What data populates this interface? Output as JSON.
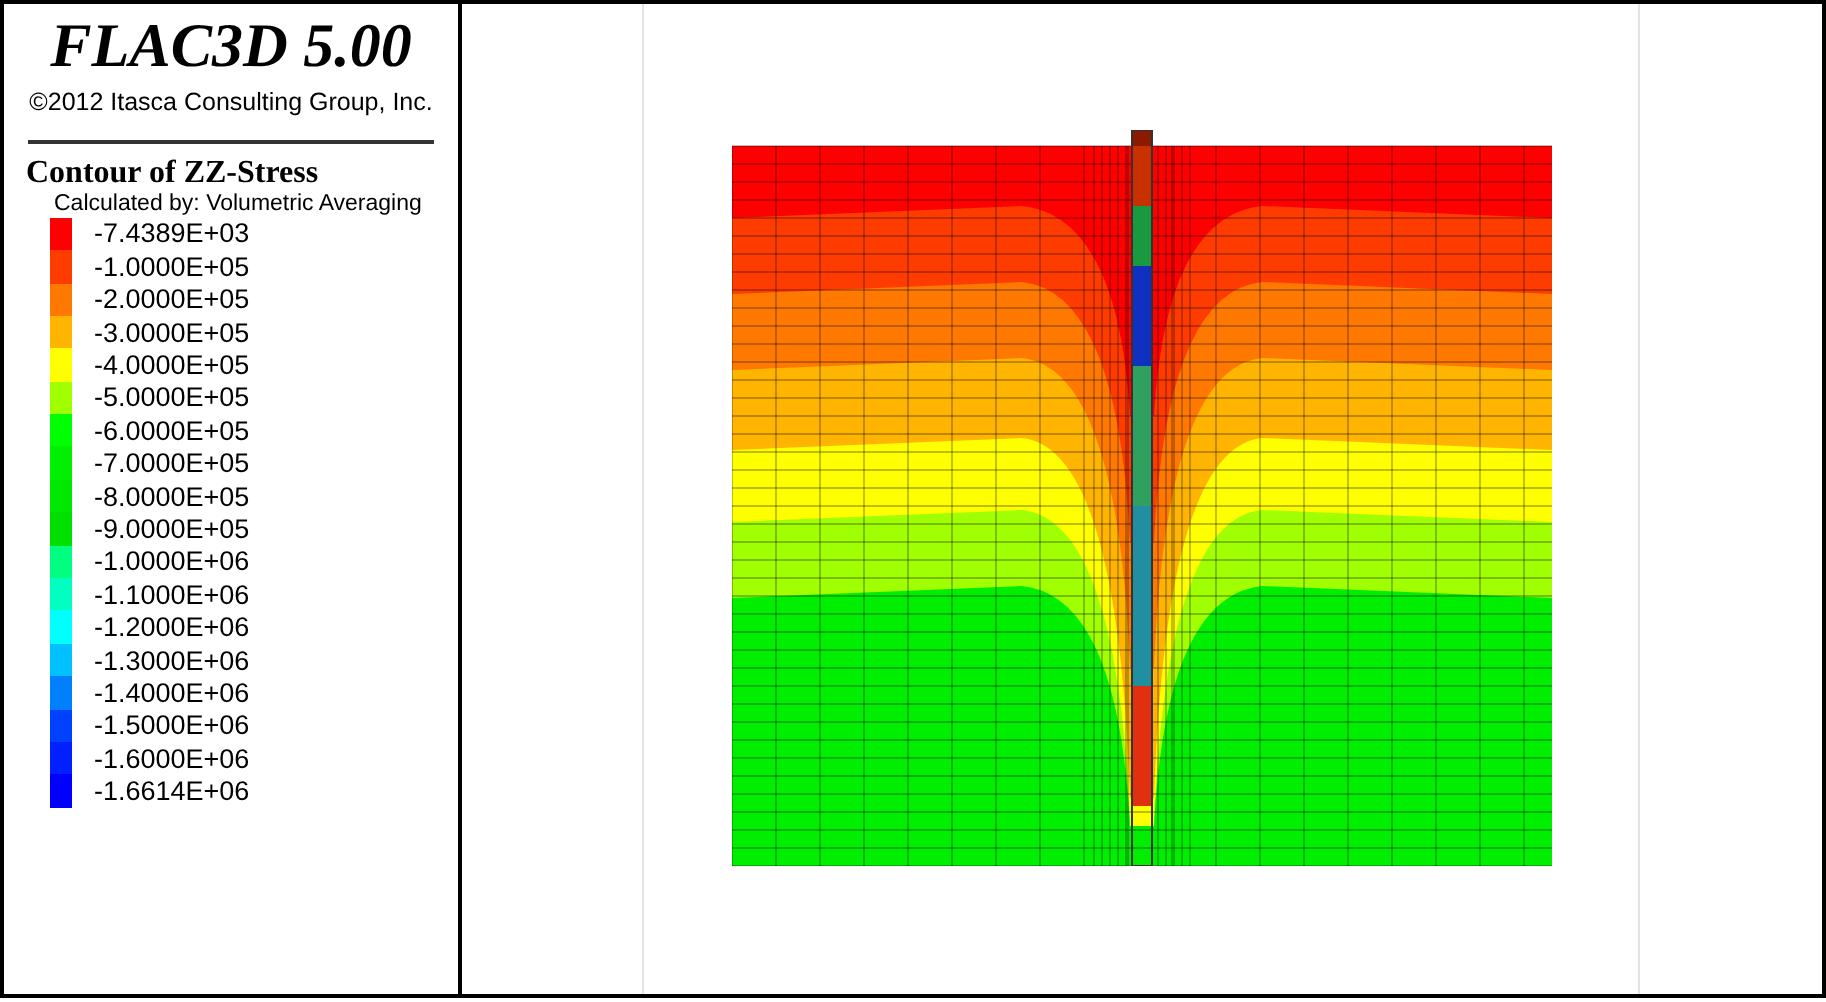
{
  "header": {
    "title": "FLAC3D 5.00",
    "copyright": "©2012 Itasca Consulting Group, Inc."
  },
  "legend": {
    "title": "Contour of ZZ-Stress",
    "subtitle": "Calculated by: Volumetric Averaging",
    "entries": [
      {
        "label": "-7.4389E+03",
        "color": "#ff0000"
      },
      {
        "label": "-1.0000E+05",
        "color": "#ff3c00"
      },
      {
        "label": "-2.0000E+05",
        "color": "#ff7800"
      },
      {
        "label": "-3.0000E+05",
        "color": "#ffb400"
      },
      {
        "label": "-4.0000E+05",
        "color": "#ffff00"
      },
      {
        "label": "-5.0000E+05",
        "color": "#a0ff00"
      },
      {
        "label": "-6.0000E+05",
        "color": "#00ff00"
      },
      {
        "label": "-7.0000E+05",
        "color": "#00f000"
      },
      {
        "label": "-8.0000E+05",
        "color": "#00e800"
      },
      {
        "label": "-9.0000E+05",
        "color": "#00e000"
      },
      {
        "label": "-1.0000E+06",
        "color": "#00ff80"
      },
      {
        "label": "-1.1000E+06",
        "color": "#00ffc0"
      },
      {
        "label": "-1.2000E+06",
        "color": "#00ffff"
      },
      {
        "label": "-1.3000E+06",
        "color": "#00c0ff"
      },
      {
        "label": "-1.4000E+06",
        "color": "#0080ff"
      },
      {
        "label": "-1.5000E+06",
        "color": "#0040ff"
      },
      {
        "label": "-1.6000E+06",
        "color": "#0020ff"
      },
      {
        "label": "-1.6614E+06",
        "color": "#0000ff"
      }
    ]
  }
}
